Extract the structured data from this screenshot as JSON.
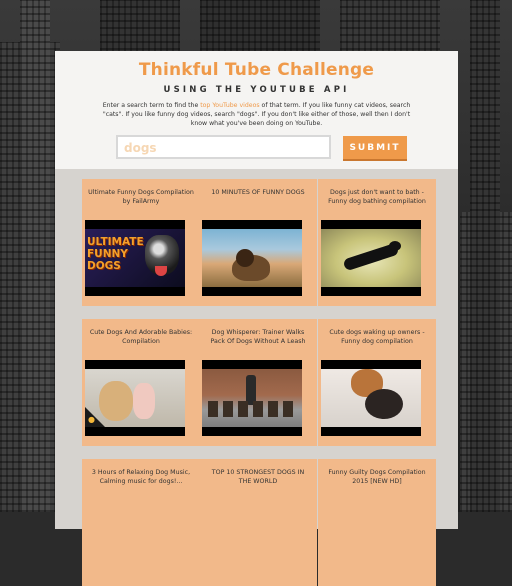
{
  "header": {
    "title": "Thinkful Tube Challenge",
    "subtitle": "USING THE YOUTUBE API",
    "intro_before": "Enter a search term to find the ",
    "intro_highlight": "top YouTube videos",
    "intro_after": " of that term. If you like funny cat videos, search \"cats\". If you like funny dog videos, search \"dogs\". If you don't like either of those, well then I don't know what you've been doing on YouTube."
  },
  "search": {
    "value": "dogs",
    "submit_label": "SUBMIT"
  },
  "results": [
    {
      "title": "Ultimate Funny Dogs Compilation by FailArmy",
      "thumb_text": "ULTIMATE FUNNY DOGS"
    },
    {
      "title": "10 MINUTES OF FUNNY DOGS"
    },
    {
      "title": "Dogs just don't want to bath - Funny dog bathing compilation"
    },
    {
      "title": "Cute Dogs And Adorable Babies: Compilation"
    },
    {
      "title": "Dog Whisperer: Trainer Walks Pack Of Dogs Without A Leash"
    },
    {
      "title": "Cute dogs waking up owners - Funny dog compilation"
    },
    {
      "title": "3 Hours of Relaxing Dog Music, Calming music for dogs!..."
    },
    {
      "title": "TOP 10 STRONGEST DOGS IN THE WORLD"
    },
    {
      "title": "Funny Guilty Dogs Compilation 2015 [NEW HD]"
    }
  ],
  "colors": {
    "accent": "#ef9a4a",
    "card": "#f2b98a",
    "panel": "#f5f4f2"
  }
}
